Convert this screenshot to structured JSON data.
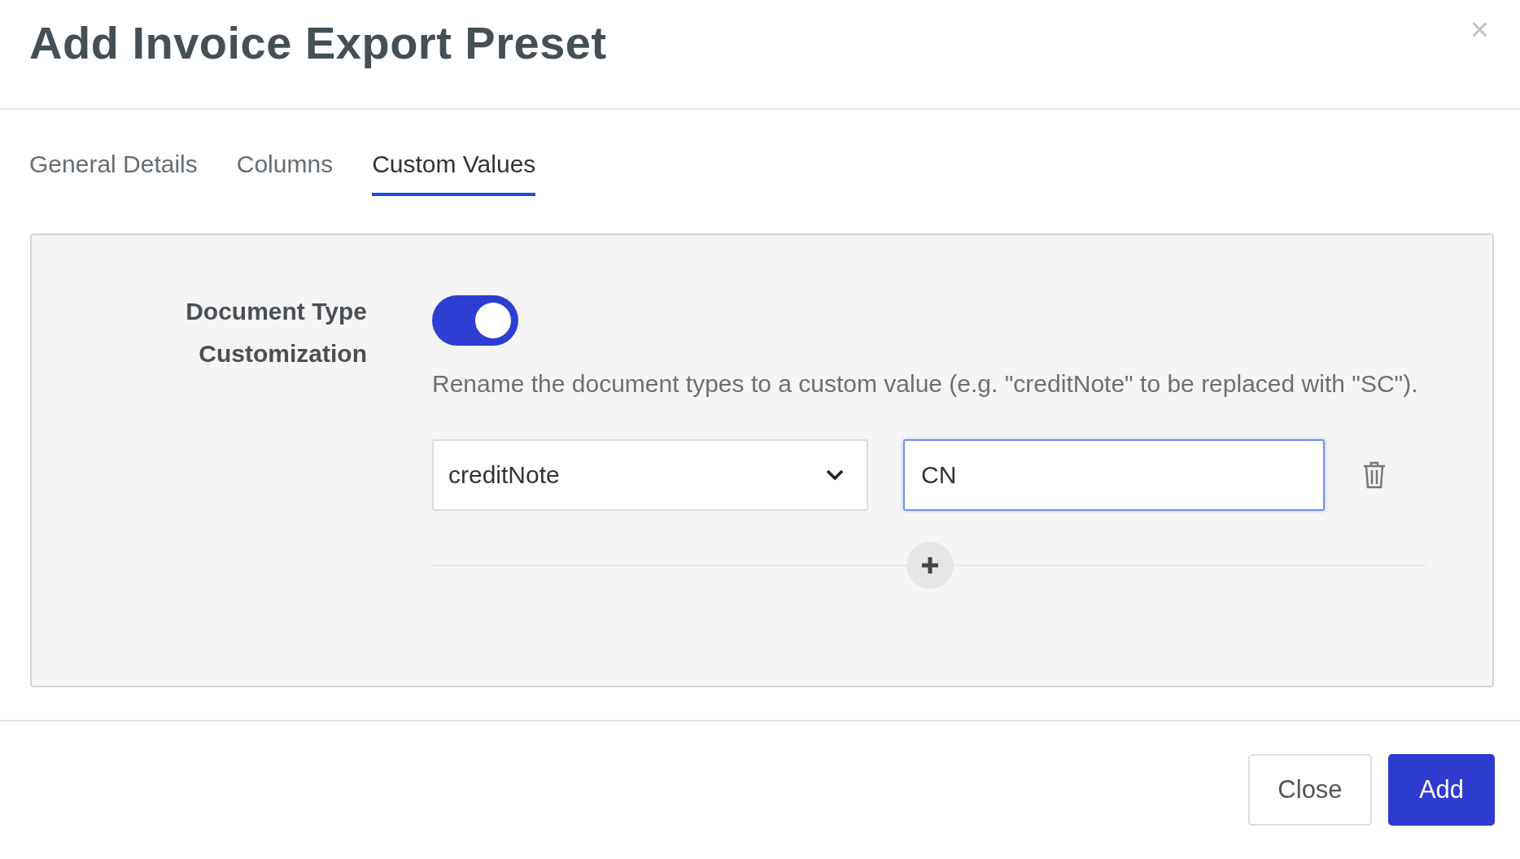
{
  "dialog": {
    "title": "Add Invoice Export Preset",
    "close_symbol": "×"
  },
  "tabs": [
    {
      "label": "General Details",
      "selected": false
    },
    {
      "label": "Columns",
      "selected": false
    },
    {
      "label": "Custom Values",
      "selected": true
    }
  ],
  "setting": {
    "label_lines": [
      "Document Type",
      "Customization"
    ],
    "on": true,
    "description": "Rename the document types to a custom value (e.g. \"creditNote\" to be replaced with \"SC\").",
    "mappings": [
      {
        "type": "creditNote",
        "value": "CN",
        "focused": true
      }
    ]
  },
  "buttons": [
    {
      "label": "Close",
      "kind": "secondary"
    },
    {
      "label": "Add",
      "kind": "primary"
    }
  ]
}
